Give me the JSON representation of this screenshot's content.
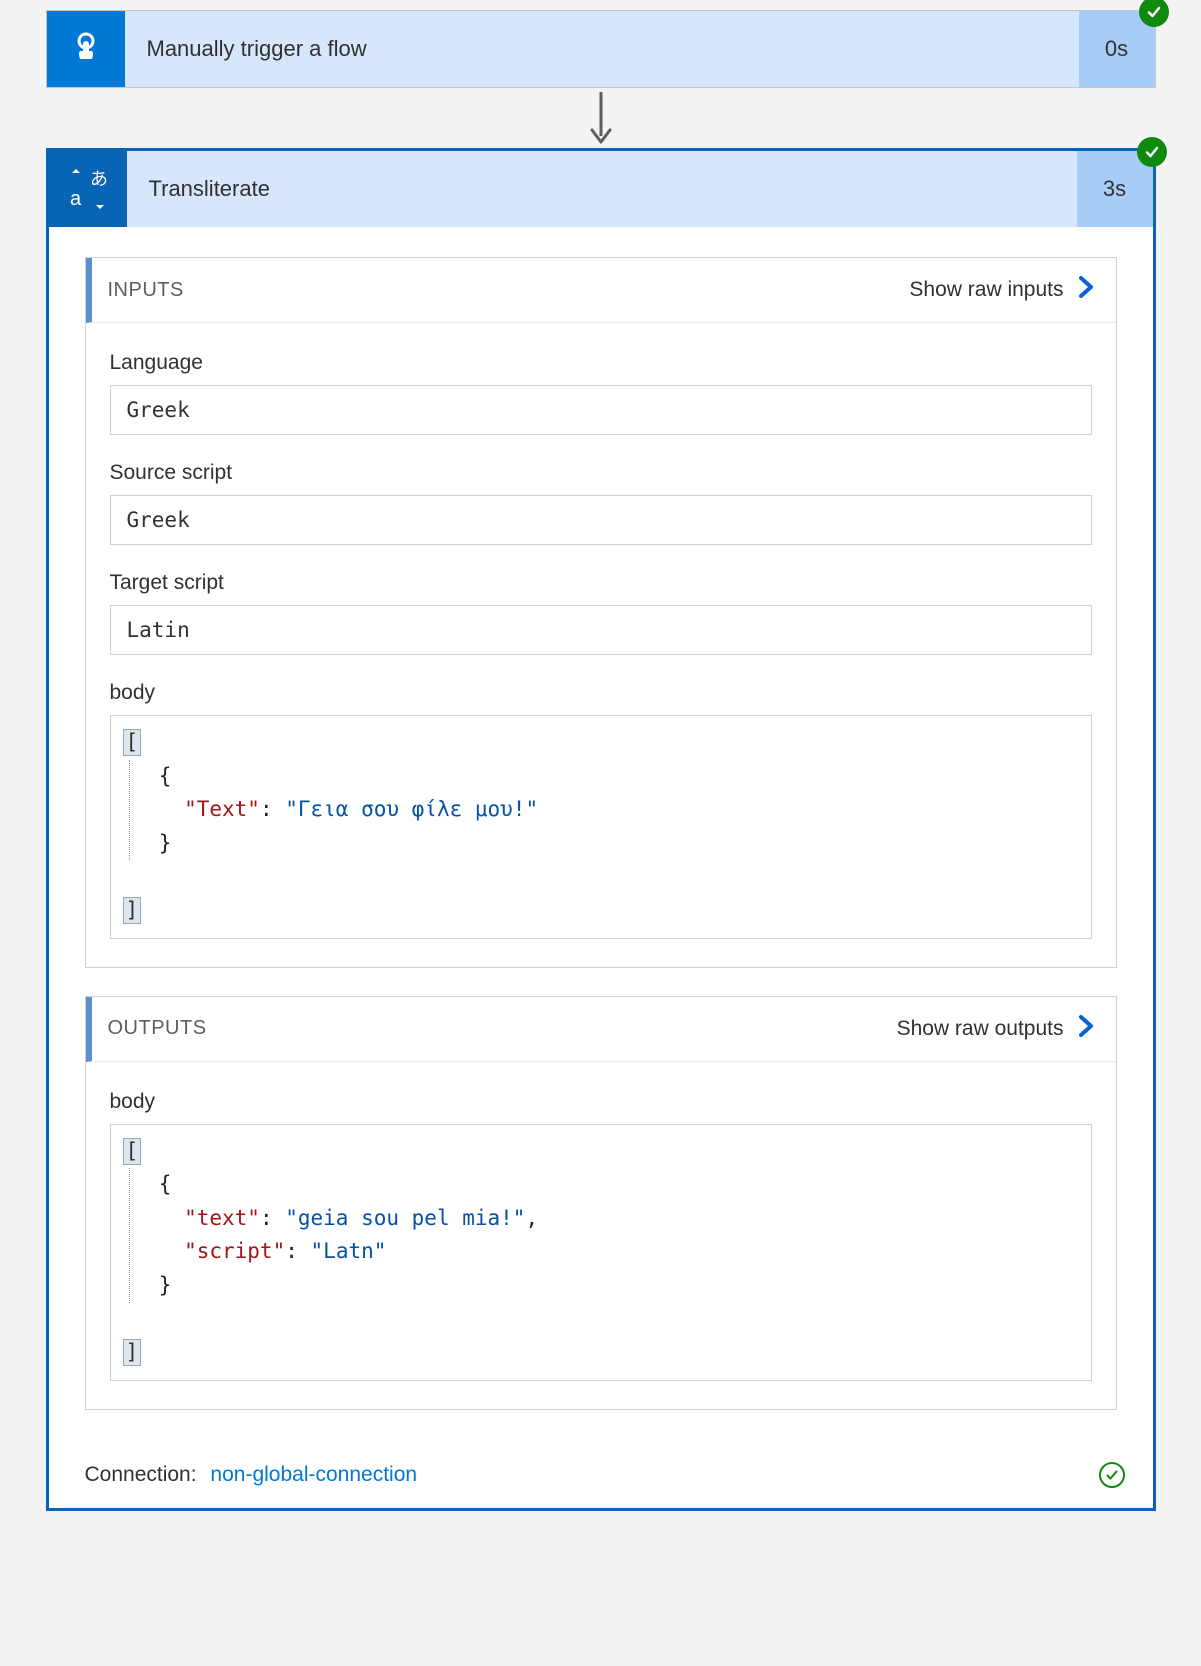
{
  "trigger": {
    "title": "Manually trigger a flow",
    "time": "0s"
  },
  "action": {
    "title": "Transliterate",
    "time": "3s"
  },
  "inputs": {
    "header": "INPUTS",
    "show_raw": "Show raw inputs",
    "fields": {
      "language_label": "Language",
      "language_value": "Greek",
      "source_label": "Source script",
      "source_value": "Greek",
      "target_label": "Target script",
      "target_value": "Latin",
      "body_label": "body",
      "body_json_key": "\"Text\"",
      "body_json_val": "\"Γεια σου φίλε μου!\""
    }
  },
  "outputs": {
    "header": "OUTPUTS",
    "show_raw": "Show raw outputs",
    "body_label": "body",
    "json_key1": "\"text\"",
    "json_val1": "\"geia sou pel mia!\"",
    "json_key2": "\"script\"",
    "json_val2": "\"Latn\""
  },
  "footer": {
    "label": "Connection:",
    "link": "non-global-connection"
  }
}
